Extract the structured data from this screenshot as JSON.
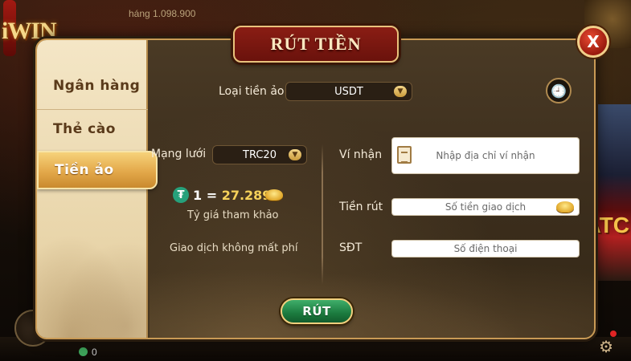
{
  "background": {
    "logo": "iWIN",
    "jackpot_text": "háng 1.098.900",
    "side_banner_text": "ATC",
    "wallet_amount": "0"
  },
  "dialog": {
    "title": "RÚT TIỀN",
    "close_label": "X",
    "sidebar": {
      "items": [
        {
          "label": "Ngân hàng",
          "active": false
        },
        {
          "label": "Thẻ cào",
          "active": false
        },
        {
          "label": "Tiền ảo",
          "active": true
        }
      ]
    },
    "crypto_type": {
      "label": "Loại tiền ảo",
      "value": "USDT"
    },
    "network": {
      "label": "Mạng lưới",
      "value": "TRC20"
    },
    "rate": {
      "prefix": "1 = ",
      "value": "27.289",
      "caption": "Tỷ giá tham khảo"
    },
    "fee_note": "Giao dịch không mất phí",
    "form": {
      "wallet": {
        "label": "Ví nhận",
        "placeholder": "Nhập địa chỉ ví nhận"
      },
      "amount": {
        "label": "Tiền rút",
        "placeholder": "Số tiền giao dịch"
      },
      "phone": {
        "label": "SĐT",
        "placeholder": "Số điện thoại"
      }
    },
    "submit_label": "RÚT"
  },
  "colors": {
    "accent_gold": "#e9c27c",
    "title_red": "#7a1710",
    "submit_green": "#1b7a3e",
    "usdt_green": "#26a17b"
  }
}
